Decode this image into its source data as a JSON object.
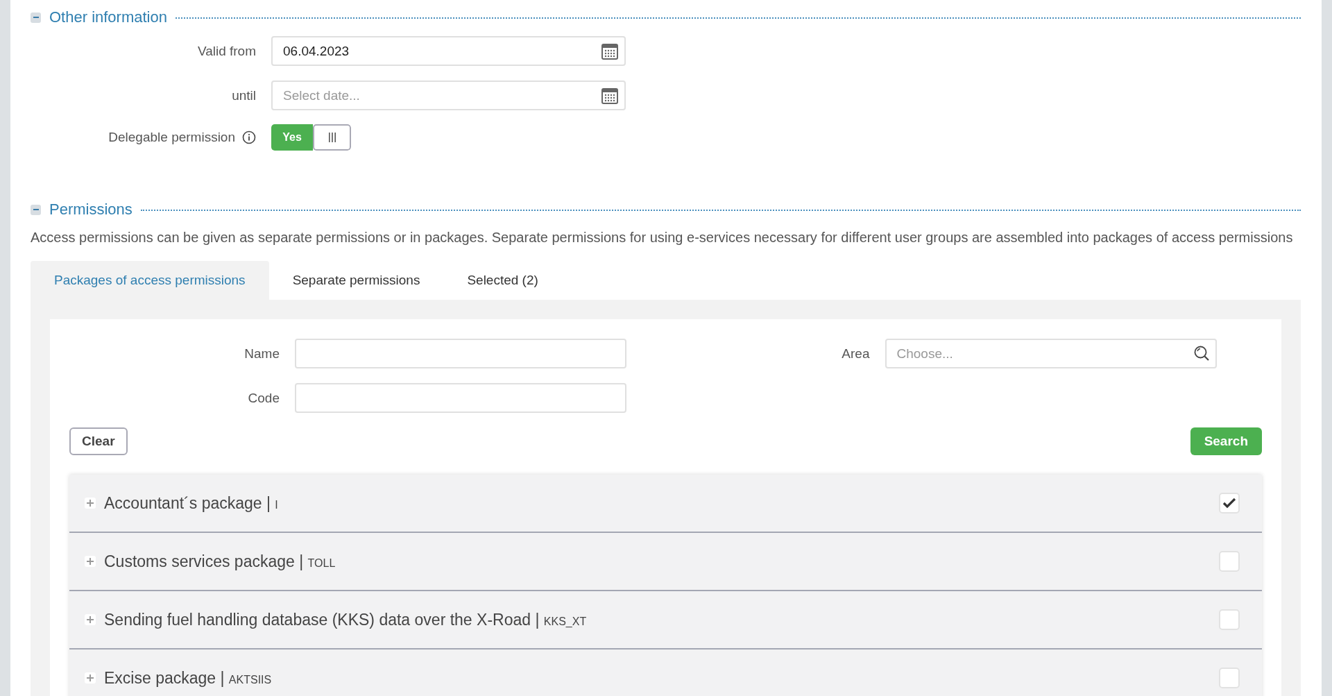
{
  "other_information": {
    "title": "Other information",
    "expanded": true,
    "valid_from": {
      "label": "Valid from",
      "value": "06.04.2023"
    },
    "until": {
      "label": "until",
      "placeholder": "Select date..."
    },
    "delegable": {
      "label": "Delegable permission",
      "on": true,
      "on_label": "Yes"
    }
  },
  "permissions": {
    "title": "Permissions",
    "expanded": true,
    "description": "Access permissions can be given as separate permissions or in packages. Separate permissions for using e-services necessary for different user groups are assembled into packages of access permissions",
    "tabs": [
      {
        "label": "Packages of access permissions",
        "selected": true
      },
      {
        "label": "Separate permissions",
        "selected": false
      },
      {
        "label": "Selected (2)",
        "selected": false
      }
    ],
    "filters": {
      "name": {
        "label": "Name"
      },
      "code": {
        "label": "Code"
      },
      "area": {
        "label": "Area",
        "placeholder": "Choose..."
      }
    },
    "buttons": {
      "clear": "Clear",
      "search": "Search"
    },
    "packages": [
      {
        "name": "Accountant´s package",
        "separator": "|",
        "code": "I",
        "checked": true
      },
      {
        "name": "Customs services package",
        "separator": "|",
        "code": "TOLL",
        "checked": false
      },
      {
        "name": "Sending fuel handling database (KKS) data over the X-Road",
        "separator": "|",
        "code": "KKS_XT",
        "checked": false
      },
      {
        "name": "Excise package",
        "separator": "|",
        "code": "AKTSIIS",
        "checked": false
      }
    ]
  }
}
